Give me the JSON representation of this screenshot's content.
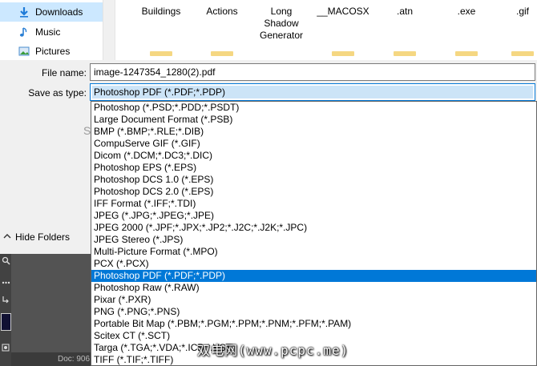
{
  "nav": {
    "items": [
      {
        "label": "Downloads",
        "icon": "download-arrow-icon",
        "selected": true
      },
      {
        "label": "Music",
        "icon": "music-note-icon",
        "selected": false
      },
      {
        "label": "Pictures",
        "icon": "pictures-icon",
        "selected": false
      }
    ]
  },
  "files": [
    {
      "line1": "Buildings",
      "line2": "",
      "line3": ""
    },
    {
      "line1": "Actions",
      "line2": "",
      "line3": ""
    },
    {
      "line1": "Long",
      "line2": "Shadow",
      "line3": "Generator"
    },
    {
      "line1": "__MACOSX",
      "line2": "",
      "line3": ""
    },
    {
      "line1": ".atn",
      "line2": "",
      "line3": ""
    },
    {
      "line1": ".exe",
      "line2": "",
      "line3": ""
    },
    {
      "line1": ".gif",
      "line2": "",
      "line3": ""
    }
  ],
  "form": {
    "filename_label": "File name:",
    "filename_value": "image-1247354_1280(2).pdf",
    "type_label": "Save as type:",
    "type_value": "Photoshop PDF (*.PDF;*.PDP)"
  },
  "type_options": [
    "Photoshop (*.PSD;*.PDD;*.PSDT)",
    "Large Document Format (*.PSB)",
    "BMP (*.BMP;*.RLE;*.DIB)",
    "CompuServe GIF (*.GIF)",
    "Dicom (*.DCM;*.DC3;*.DIC)",
    "Photoshop EPS (*.EPS)",
    "Photoshop DCS 1.0 (*.EPS)",
    "Photoshop DCS 2.0 (*.EPS)",
    "IFF Format (*.IFF;*.TDI)",
    "JPEG (*.JPG;*.JPEG;*.JPE)",
    "JPEG 2000 (*.JPF;*.JPX;*.JP2;*.J2C;*.J2K;*.JPC)",
    "JPEG Stereo (*.JPS)",
    "Multi-Picture Format (*.MPO)",
    "PCX (*.PCX)",
    "Photoshop PDF (*.PDF;*.PDP)",
    "Photoshop Raw (*.RAW)",
    "Pixar (*.PXR)",
    "PNG (*.PNG;*.PNS)",
    "Portable Bit Map (*.PBM;*.PGM;*.PPM;*.PNM;*.PFM;*.PAM)",
    "Scitex CT (*.SCT)",
    "Targa (*.TGA;*.VDA;*.ICB;*.VST)",
    "TIFF (*.TIF;*.TIFF)"
  ],
  "selected_type_index": 14,
  "hide_folders": "Hide Folders",
  "stray_char": "S",
  "ps_status": "Doc: 906",
  "watermark": "双电网(www.pcpc.me)",
  "colors": {
    "selection": "#0078d7",
    "nav_selected": "#cce8ff",
    "folder": "#f5d782"
  }
}
